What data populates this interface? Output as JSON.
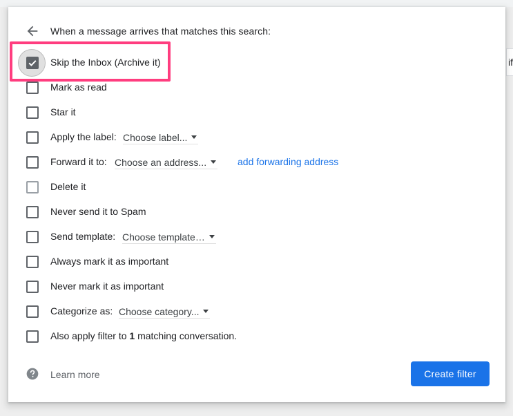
{
  "header": {
    "title": "When a message arrives that matches this search:"
  },
  "background": {
    "edge_text": "if"
  },
  "options": [
    {
      "label": "Skip the Inbox (Archive it)",
      "checked": true
    },
    {
      "label": "Mark as read",
      "checked": false
    },
    {
      "label": "Star it",
      "checked": false
    },
    {
      "label": "Apply the label:",
      "select": "Choose label...",
      "checked": false
    },
    {
      "label": "Forward it to:",
      "select": "Choose an address...",
      "link": "add forwarding address",
      "checked": false
    },
    {
      "label": "Delete it",
      "checked": false,
      "disabled_look": true
    },
    {
      "label": "Never send it to Spam",
      "checked": false
    },
    {
      "label": "Send template:",
      "select": "Choose template…",
      "checked": false
    },
    {
      "label": "Always mark it as important",
      "checked": false
    },
    {
      "label": "Never mark it as important",
      "checked": false
    },
    {
      "label": "Categorize as:",
      "select": "Choose category...",
      "checked": false
    },
    {
      "label_pre": "Also apply filter to ",
      "label_count": "1",
      "label_post": " matching conversation.",
      "checked": false
    }
  ],
  "footer": {
    "learn_more": "Learn more",
    "create_filter": "Create filter"
  },
  "colors": {
    "accent": "#1a73e8",
    "highlight": "#ff3d7f",
    "checkbox": "#5f6368"
  },
  "icons": {
    "back": "arrow-left-icon",
    "help": "help-circle-icon",
    "check": "checkmark-icon",
    "dropdown": "caret-down-icon"
  }
}
